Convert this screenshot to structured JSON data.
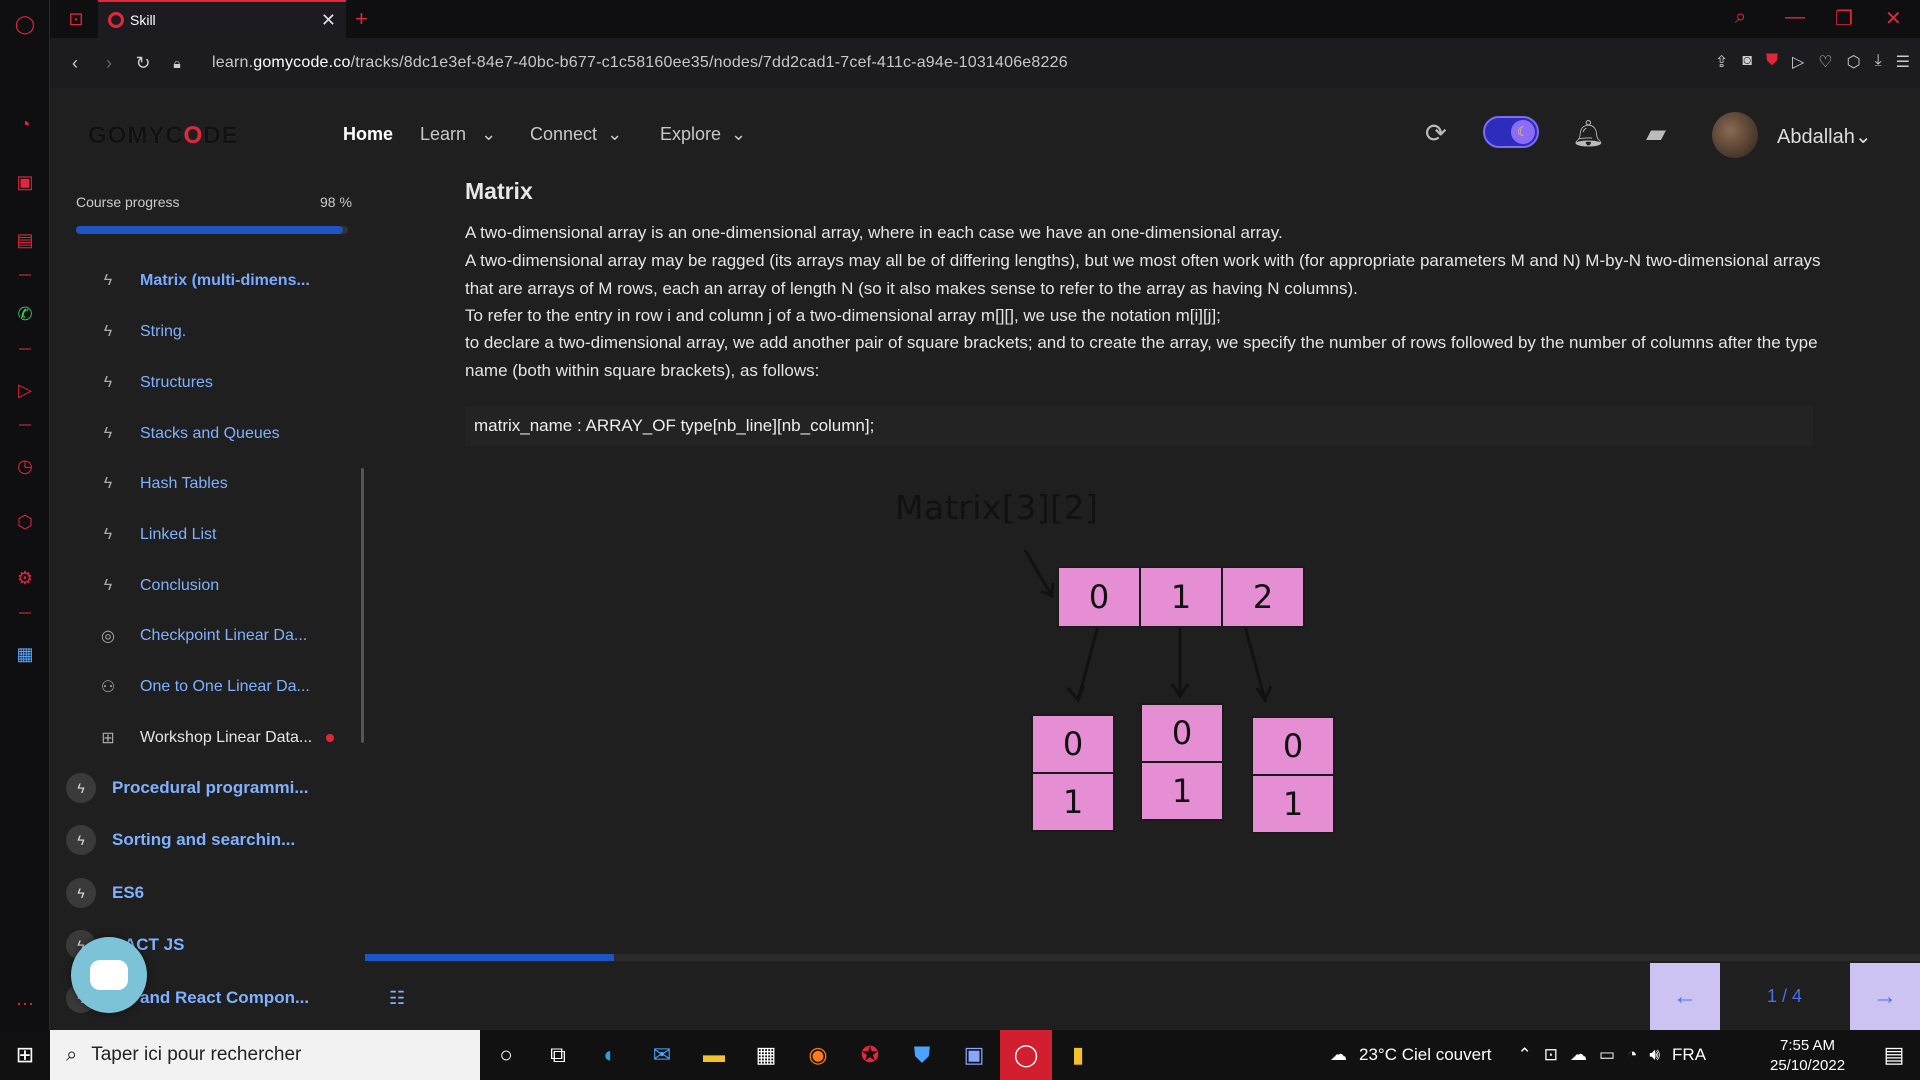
{
  "browser": {
    "tab_title": "Skill",
    "url_prefix": "learn.",
    "url_domain": "gomycode.co",
    "url_path": "/tracks/8dc1e3ef-84e7-40bc-b677-c1c58160ee35/nodes/7dd2cad1-7cef-411c-a94e-1031406e8226"
  },
  "header": {
    "logo_pre": "GOMYC",
    "logo_o": "O",
    "logo_post": "DE",
    "nav": [
      "Home",
      "Learn",
      "Connect",
      "Explore"
    ],
    "username": "Abdallah"
  },
  "sidebar": {
    "progress_label": "Course progress",
    "progress_pct": "98 %",
    "progress_value": 0.98,
    "lessons": [
      {
        "label": "Matrix (multi-dimens...",
        "icon": "bolt-icon",
        "active": true
      },
      {
        "label": "String.",
        "icon": "bolt-icon"
      },
      {
        "label": "Structures",
        "icon": "bolt-icon"
      },
      {
        "label": "Stacks and Queues",
        "icon": "bolt-icon"
      },
      {
        "label": "Hash Tables",
        "icon": "bolt-icon"
      },
      {
        "label": "Linked List",
        "icon": "bolt-icon"
      },
      {
        "label": "Conclusion",
        "icon": "bolt-icon"
      },
      {
        "label": "Checkpoint Linear Da...",
        "icon": "target-icon"
      },
      {
        "label": "One to One Linear Da...",
        "icon": "people-icon"
      },
      {
        "label": "Workshop Linear Data...",
        "icon": "workshop-icon"
      }
    ],
    "modules": [
      "Procedural programmi...",
      "Sorting and searchin...",
      "ES6",
      "ACT JS",
      "X and React Compon..."
    ]
  },
  "content": {
    "title": "Matrix",
    "paragraphs": [
      "A two-dimensional array is an one-dimensional array, where in each case we have an one-dimensional array.",
      "A two-dimensional array may be ragged (its arrays may all be of differing lengths), but we most often work with (for appropriate parameters M and N) M-by-N two-dimensional arrays that are arrays of M rows, each an array of length N (so it also makes sense to refer to the array as having N columns).",
      "To refer to the entry in row i and column j of a two-dimensional array m[][], we use the notation m[i][j];",
      "to declare a two-dimensional array, we add another pair of square brackets; and to create the array, we specify the number of rows followed by the number of columns after the type name (both within square brackets), as follows:"
    ],
    "code": "matrix_name : ARRAY_OF type[nb_line][nb_column];",
    "diagram": {
      "title": "Matrix[3][2]",
      "top_cells": [
        "0",
        "1",
        "2"
      ],
      "sub_cells": [
        [
          "0",
          "1"
        ],
        [
          "0",
          "1"
        ],
        [
          "0",
          "1"
        ]
      ]
    }
  },
  "lesson_nav": {
    "page_indicator": "1 / 4",
    "progress_value": 0.16,
    "prev_icon": "arrow-left-icon",
    "next_icon": "arrow-right-icon"
  },
  "taskbar": {
    "search_placeholder": "Taper ici pour rechercher",
    "weather": "23°C  Ciel couvert",
    "lang": "FRA",
    "time": "7:55 AM",
    "date": "25/10/2022"
  }
}
